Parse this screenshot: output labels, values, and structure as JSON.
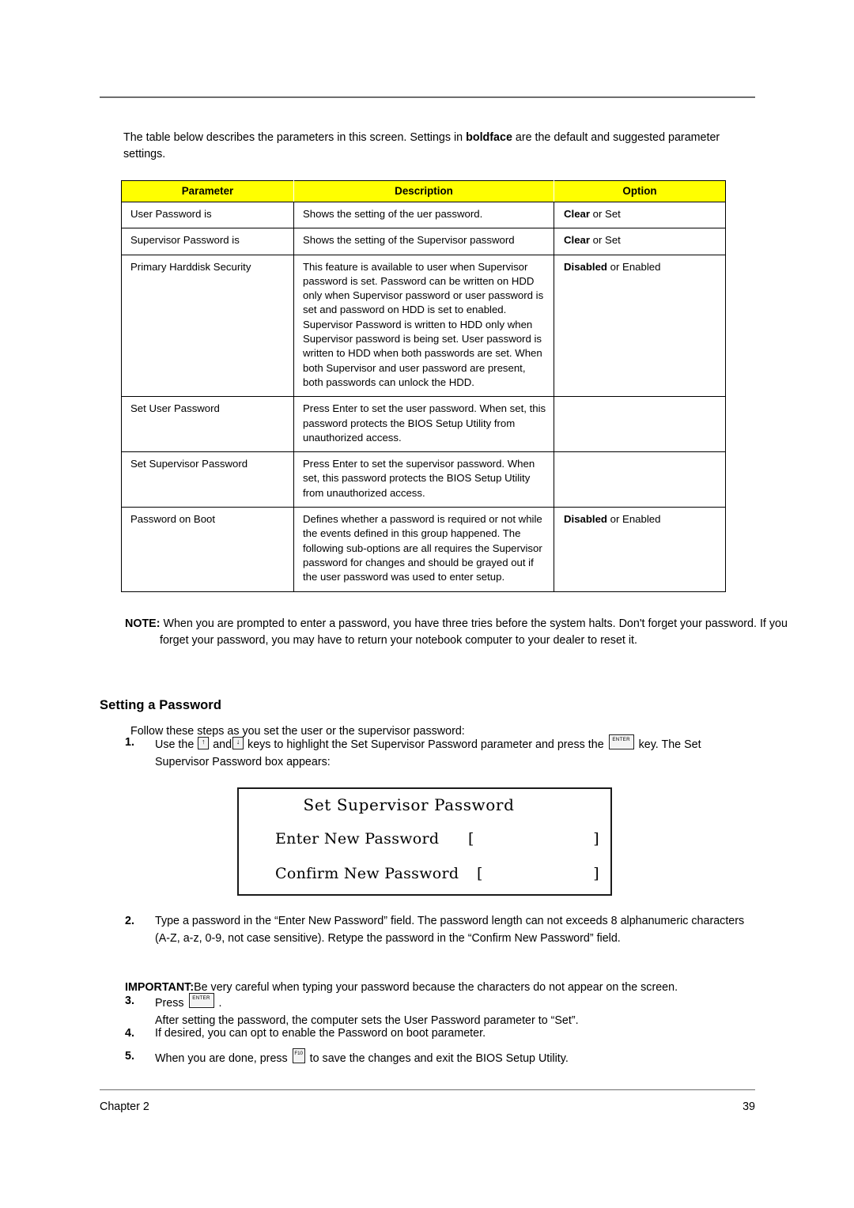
{
  "intro": {
    "before_bold": "The table below describes the parameters in this screen. Settings in ",
    "bold": "boldface",
    "after_bold": " are the default and suggested parameter settings."
  },
  "table": {
    "headers": [
      "Parameter",
      "Description",
      "Option"
    ],
    "rows": [
      {
        "parameter": "User Password is",
        "description": "Shows the setting of the uer password.",
        "option_bold": "Clear",
        "option_rest": " or Set"
      },
      {
        "parameter": "Supervisor Password is",
        "description": "Shows the setting of the Supervisor password",
        "option_bold": "Clear",
        "option_rest": " or Set"
      },
      {
        "parameter": "Primary Harddisk Security",
        "description": "This feature is available to user when Supervisor password is set. Password can be written on HDD only when Supervisor password or user password is set and password on HDD is set to enabled. Supervisor Password is written to HDD only when Supervisor password is being set. User password is written to HDD when both passwords are set. When both Supervisor and user password are present, both passwords can unlock the HDD.",
        "option_bold": "Disabled",
        "option_rest": " or Enabled"
      },
      {
        "parameter": "Set User Password",
        "description": "Press Enter to set the user password. When set, this password protects the BIOS Setup Utility from unauthorized access.",
        "option_bold": "",
        "option_rest": ""
      },
      {
        "parameter": "Set Supervisor Password",
        "description": "Press Enter to set the supervisor password. When set, this password protects the BIOS Setup Utility from unauthorized access.",
        "option_bold": "",
        "option_rest": ""
      },
      {
        "parameter": "Password on Boot",
        "description": "Defines whether a password is required or not while the events defined in this group happened. The following sub-options are all requires the Supervisor password for changes and should be grayed out if the user password was used to enter setup.",
        "option_bold": "Disabled",
        "option_rest": " or Enabled"
      }
    ]
  },
  "note": {
    "label": "NOTE:",
    "text": " When you are prompted to enter a password, you have three tries before the system halts. Don't forget your password. If you forget your password, you may have to return your notebook computer to your dealer to reset it."
  },
  "section": {
    "heading": "Setting a Password",
    "lead": "Follow these steps as you set the user or the supervisor password:"
  },
  "steps": {
    "step1": {
      "num": "1.",
      "t1": "Use the ",
      "key_up": "↑",
      "t2": " and",
      "key_down": "↓",
      "t3": " keys to highlight the Set Supervisor Password parameter and press the ",
      "key_enter": "ENTER",
      "t4": " key. The Set Supervisor Password box appears:"
    },
    "step2": {
      "num": "2.",
      "text": "Type a password in the “Enter New Password” field. The password length can not exceeds 8 alphanumeric characters (A-Z, a-z, 0-9, not case sensitive). Retype the password in the “Confirm New Password” field."
    },
    "important": {
      "label": "IMPORTANT:",
      "text": "Be very careful when typing your password because the characters do not appear on the screen."
    },
    "step3": {
      "num": "3.",
      "t1": "Press  ",
      "key_enter": "ENTER",
      "t2": " .",
      "sub": "After setting the password, the computer sets the User Password parameter to “Set”."
    },
    "step4": {
      "num": "4.",
      "text": "If desired, you can opt to enable the Password on boot parameter."
    },
    "step5": {
      "num": "5.",
      "t1": "When you are done, press ",
      "key_f10": "F10",
      "t2": " to save the changes and exit the BIOS Setup Utility."
    }
  },
  "bios_dialog": {
    "title": "Set Supervisor Password",
    "row1_label": "Enter New Password",
    "row1_bracket_left": "[",
    "row1_bracket_right": "]",
    "row2_label": "Confirm New Password",
    "row2_bracket_left": "[",
    "row2_bracket_right": "]"
  },
  "footer": {
    "left": "Chapter 2",
    "page": "39"
  },
  "colors": {
    "table_header_bg": "#FFFF00",
    "rule": "#6E6E6E",
    "text": "#000000",
    "page_bg": "#FFFFFF"
  }
}
